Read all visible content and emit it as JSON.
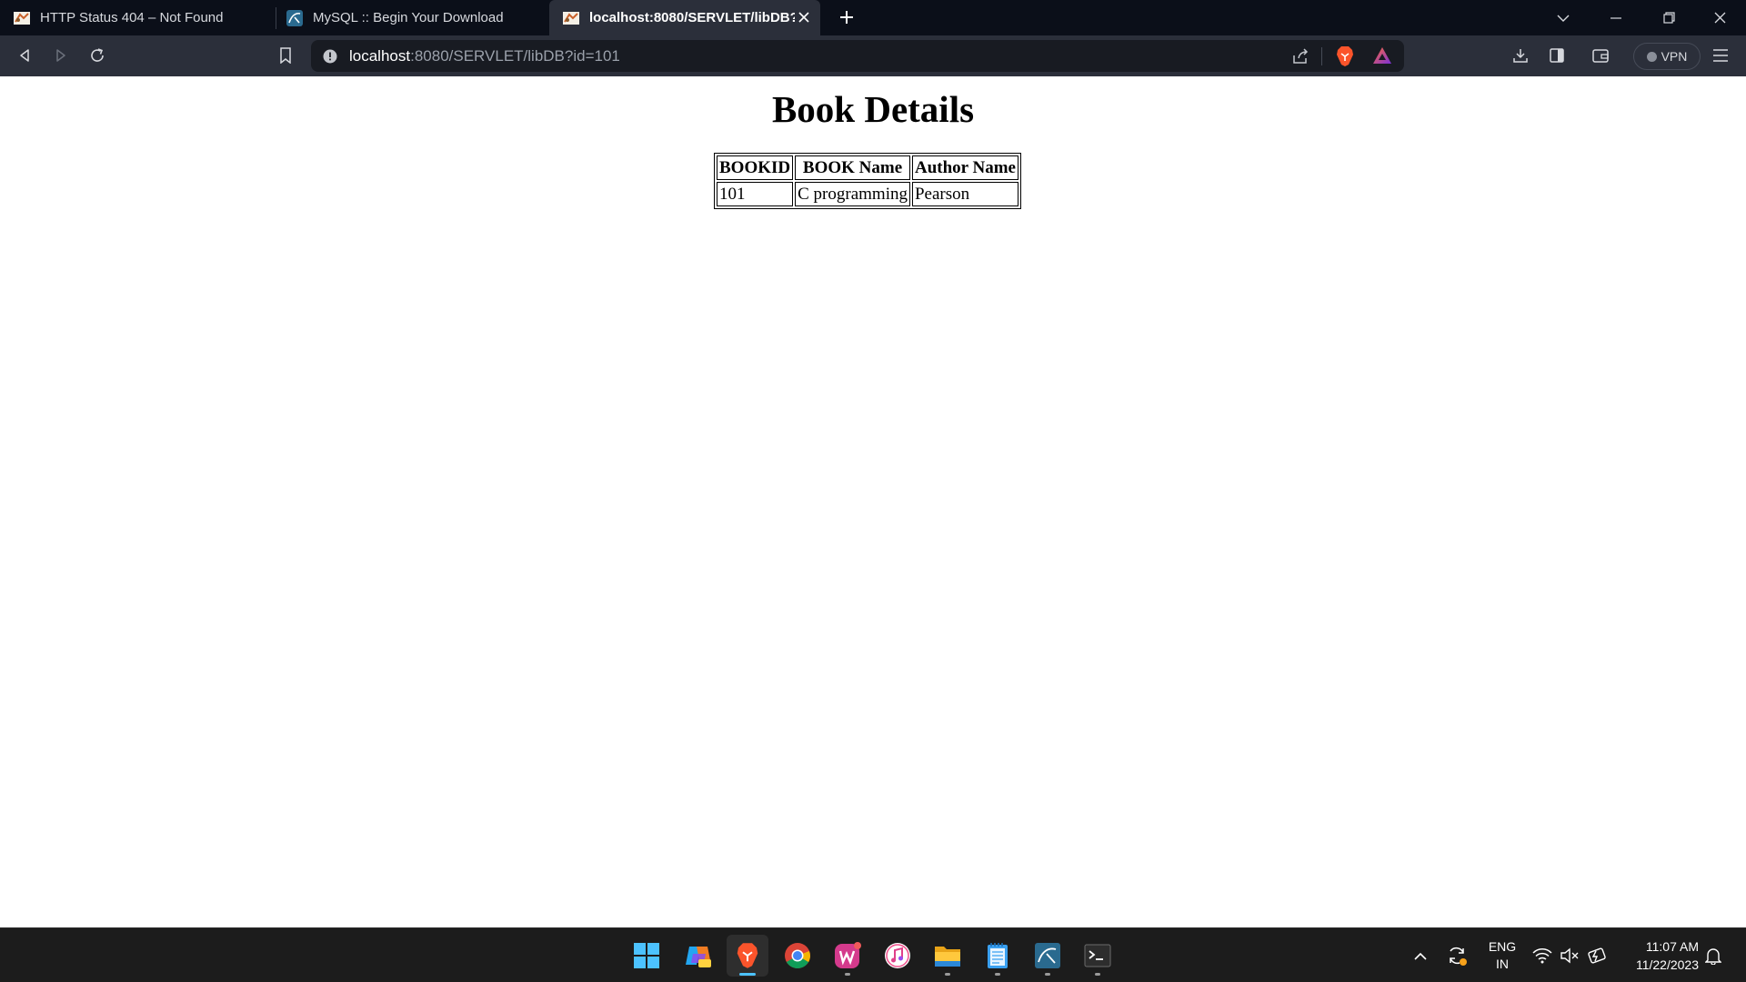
{
  "browser": {
    "tabs": [
      {
        "title": "HTTP Status 404 – Not Found",
        "favicon": "tomcat-icon",
        "active": false
      },
      {
        "title": "MySQL :: Begin Your Download",
        "favicon": "mysql-icon",
        "active": false
      },
      {
        "title": "localhost:8080/SERVLET/libDB?id=101",
        "favicon": "tomcat-icon",
        "active": true
      }
    ],
    "url": {
      "host": "localhost",
      "path": ":8080/SERVLET/libDB?id=101"
    },
    "vpn_label": "VPN"
  },
  "page": {
    "title": "Book Details",
    "table": {
      "headers": [
        "BOOKID",
        "BOOK Name",
        "Author Name"
      ],
      "rows": [
        [
          "101",
          "C programming",
          "Pearson"
        ]
      ]
    }
  },
  "taskbar": {
    "apps": [
      "start-icon",
      "copilot-icon",
      "brave-icon",
      "chrome-icon",
      "wps-office-icon",
      "itunes-icon",
      "file-explorer-icon",
      "notepad-icon",
      "mysql-workbench-icon",
      "terminal-icon"
    ],
    "language": {
      "line1": "ENG",
      "line2": "IN"
    },
    "time": "11:07 AM",
    "date": "11/22/2023"
  },
  "colors": {
    "titlebar": "#0b0f19",
    "toolbar": "#2b2f3a",
    "urlbar": "#181b22",
    "taskbar": "#1c1c1c",
    "brave_orange": "#fb542b",
    "win_blue": "#4cc2ff"
  }
}
